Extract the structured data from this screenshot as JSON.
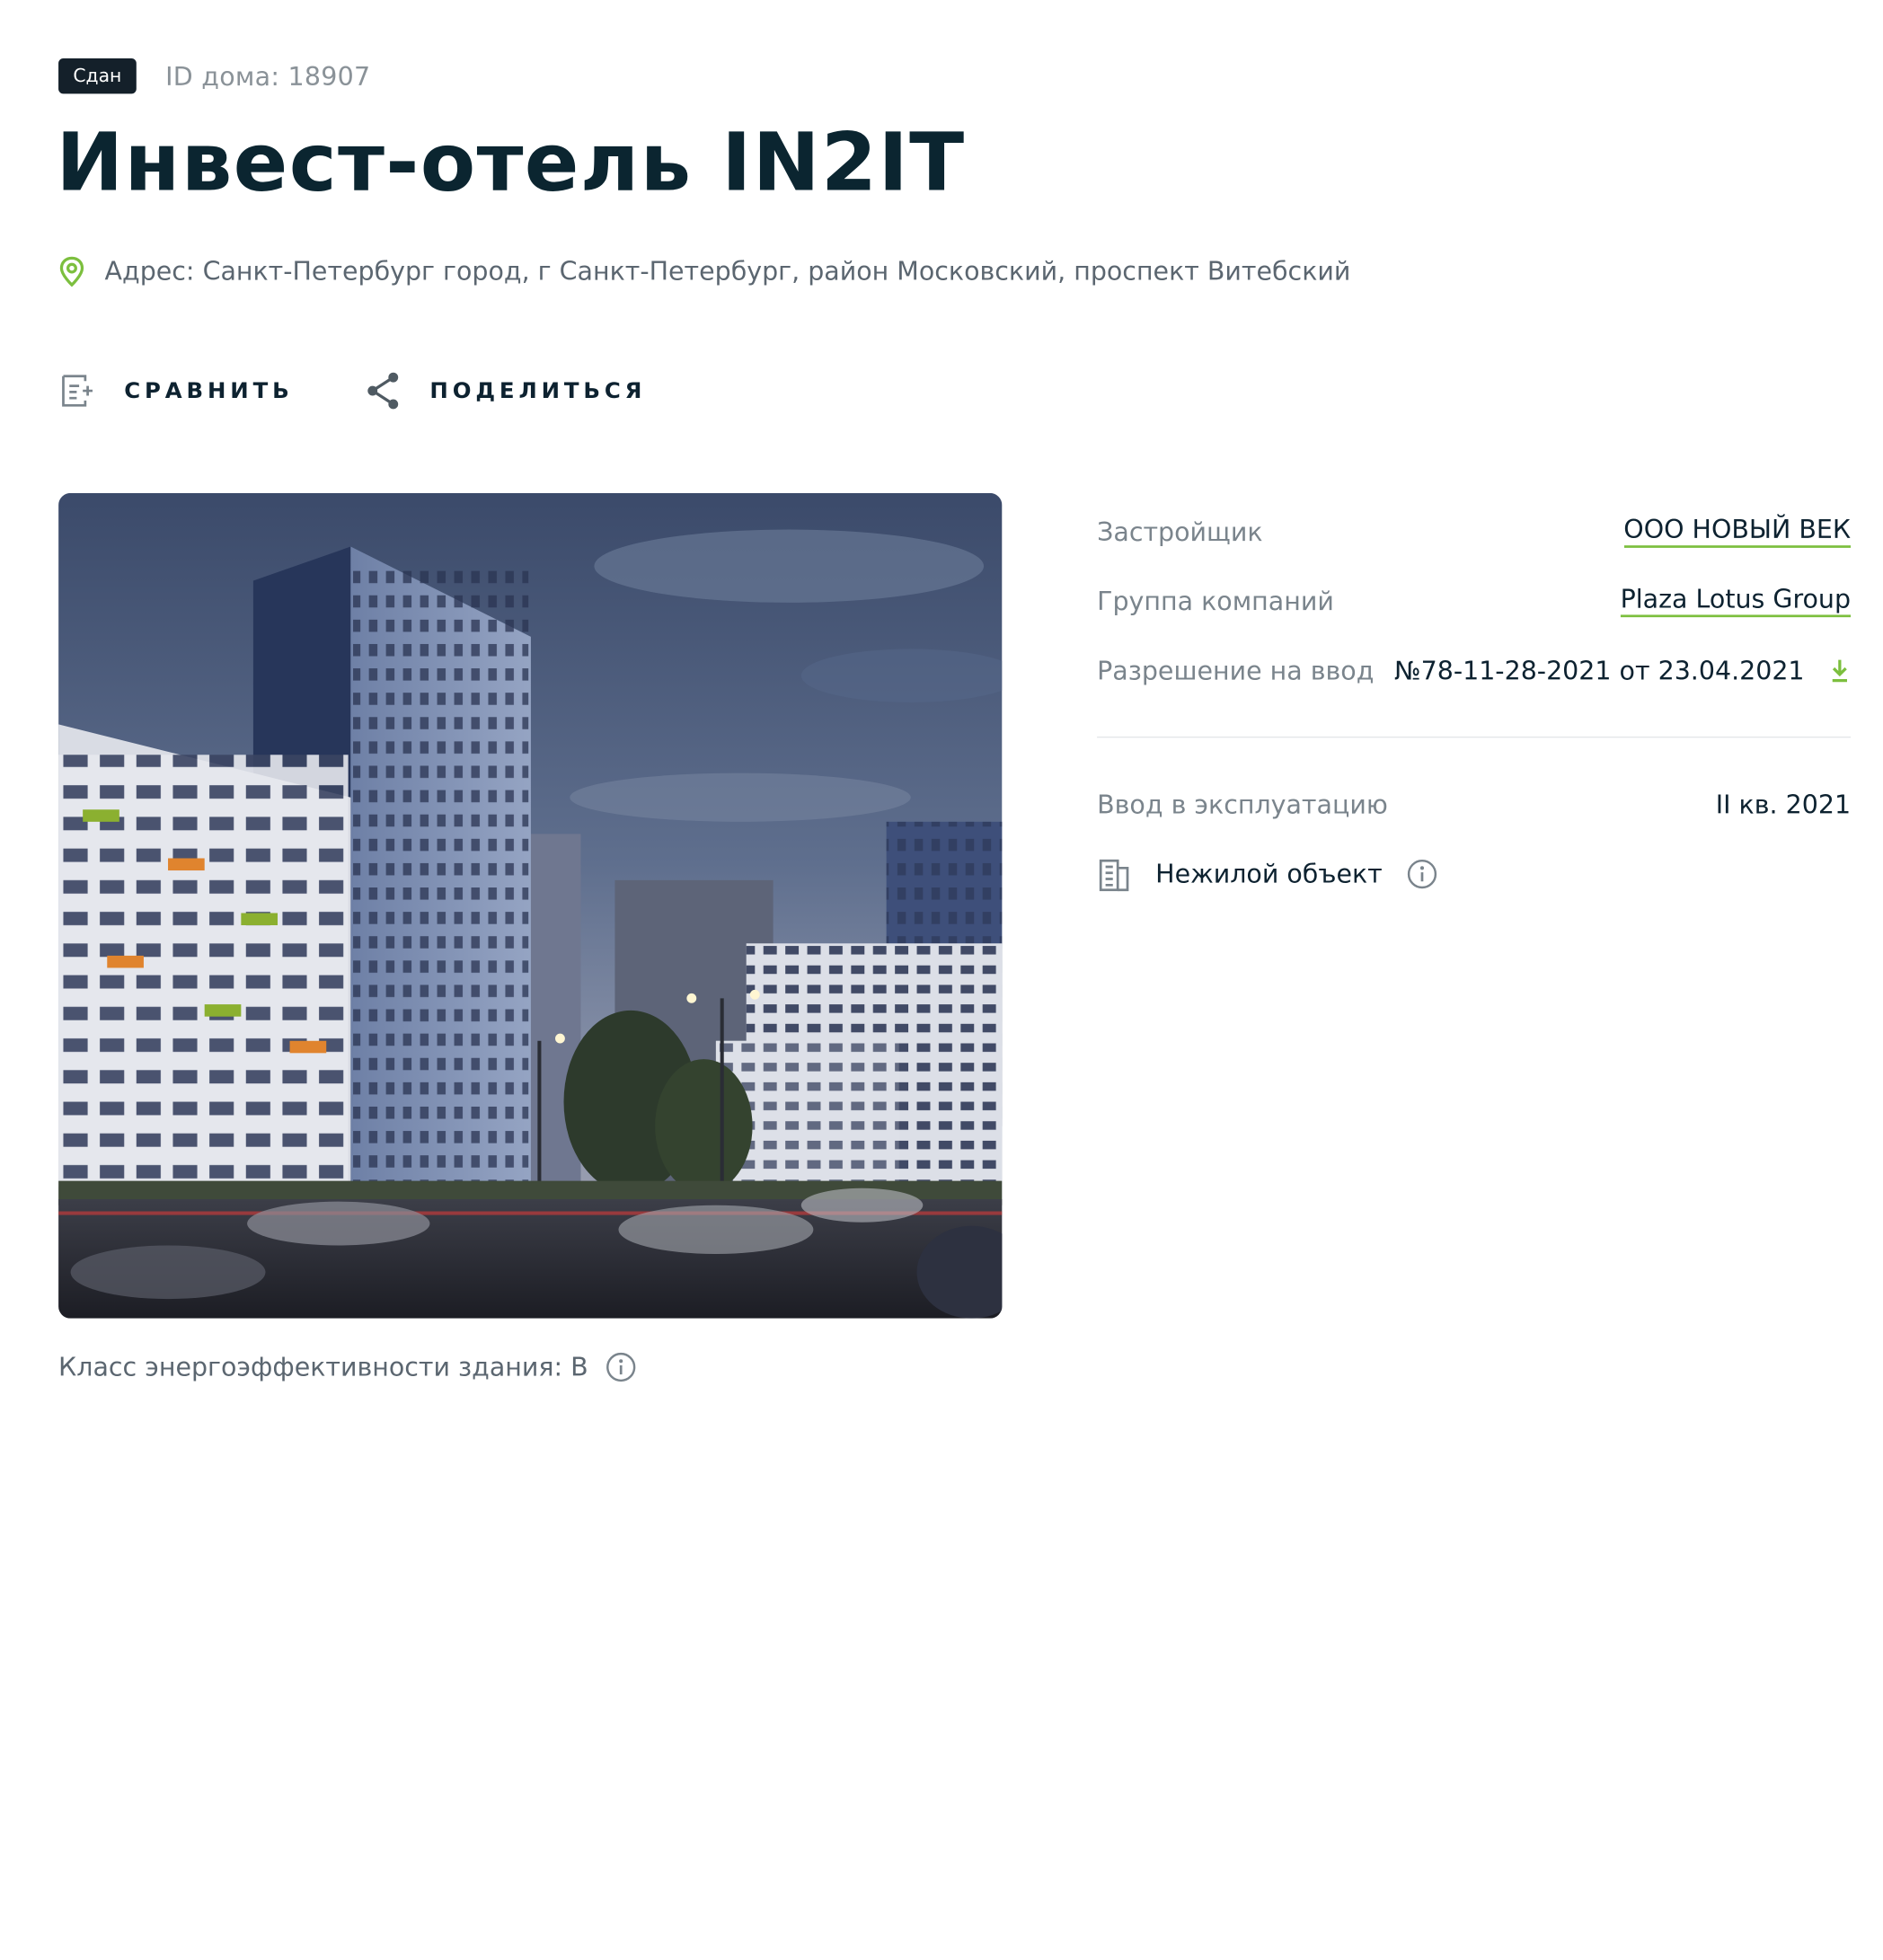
{
  "header": {
    "status_badge": "Сдан",
    "house_id": "ID дома: 18907",
    "title": "Инвест-отель IN2IT",
    "address": "Адрес: Санкт-Петербург город, г Санкт-Петербург, район Московский, проспект Витебский"
  },
  "actions": {
    "compare_label": "СРАВНИТЬ",
    "share_label": "ПОДЕЛИТЬСЯ"
  },
  "details": {
    "developer_label": "Застройщик",
    "developer_value": "ООО НОВЫЙ ВЕК",
    "group_label": "Группа компаний",
    "group_value": "Plaza Lotus Group",
    "permit_label": "Разрешение на ввод",
    "permit_value": "№78-11-28-2021 от 23.04.2021",
    "commission_label": "Ввод в эксплуатацию",
    "commission_value": "II кв. 2021",
    "object_type": "Нежилой объект"
  },
  "energy": {
    "label": "Класс энергоэффективности здания: B"
  },
  "icons": {
    "location": "location-pin-icon",
    "compare": "compare-list-icon",
    "share": "share-icon",
    "download": "download-icon",
    "building": "building-icon",
    "info": "info-icon"
  },
  "colors": {
    "accent_green": "#7cbf3e",
    "title_dark": "#0b2530",
    "badge_bg": "#14202a",
    "muted_text": "#7a848c"
  }
}
